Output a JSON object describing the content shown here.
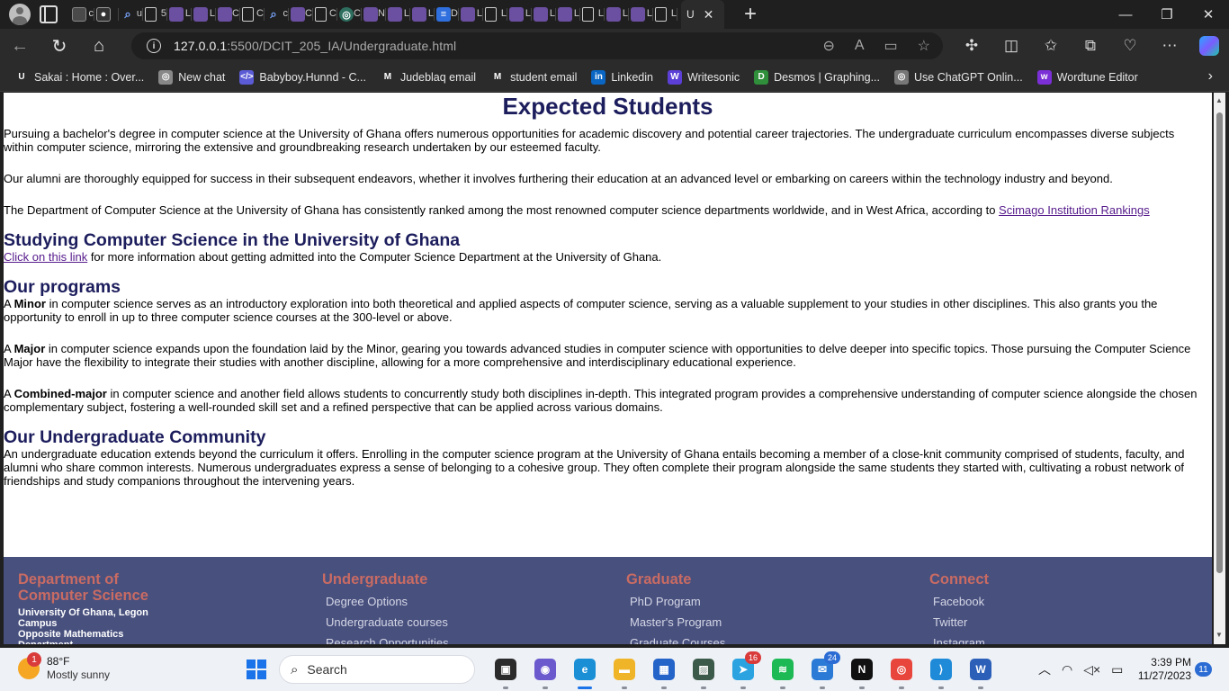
{
  "browser": {
    "tab_strip": {
      "mini_tabs": [
        {
          "icon": "tab-page-icon",
          "letter": "c"
        },
        {
          "icon": "github-icon",
          "letter": ""
        },
        {
          "icon": "search-icon",
          "letter": "u"
        },
        {
          "icon": "document-icon",
          "letter": "5"
        },
        {
          "icon": "site-icon",
          "letter": "L"
        },
        {
          "icon": "site-icon",
          "letter": "L"
        },
        {
          "icon": "site-icon",
          "letter": "C"
        },
        {
          "icon": "document-icon",
          "letter": "C"
        },
        {
          "icon": "search-icon",
          "letter": "c"
        },
        {
          "icon": "site-icon",
          "letter": "C"
        },
        {
          "icon": "document-icon",
          "letter": "C"
        },
        {
          "icon": "chatgpt-icon",
          "letter": "C"
        },
        {
          "icon": "site-icon",
          "letter": "N"
        },
        {
          "icon": "site-icon",
          "letter": "L"
        },
        {
          "icon": "site-icon",
          "letter": "L"
        },
        {
          "icon": "docs-icon",
          "letter": "D"
        },
        {
          "icon": "site-icon",
          "letter": "L"
        },
        {
          "icon": "document-icon",
          "letter": "L"
        },
        {
          "icon": "site-icon",
          "letter": "L"
        },
        {
          "icon": "site-icon",
          "letter": "L"
        },
        {
          "icon": "site-icon",
          "letter": "L"
        },
        {
          "icon": "document-icon",
          "letter": "L"
        },
        {
          "icon": "site-icon",
          "letter": "L"
        },
        {
          "icon": "site-icon",
          "letter": "L"
        },
        {
          "icon": "document-icon",
          "letter": "L"
        }
      ],
      "active_tab_label": "U",
      "new_tab_symbol": "+",
      "window_controls": {
        "minimize": "—",
        "restore": "❐",
        "close": "✕"
      }
    },
    "address_bar": {
      "url_host": "127.0.0.1",
      "url_rest": ":5500/DCIT_205_IA/Undergraduate.html"
    },
    "bookmarks": [
      {
        "label": "Sakai : Home : Over...",
        "icon": "sakai-icon",
        "color": "#2b2b2b",
        "glyph": "U"
      },
      {
        "label": "New chat",
        "icon": "chatgpt-icon",
        "color": "#888888",
        "glyph": "◎"
      },
      {
        "label": "Babyboy.Hunnd - C...",
        "icon": "code-icon",
        "color": "#5b5bd6",
        "glyph": "</>"
      },
      {
        "label": "Judeblaq email",
        "icon": "gmail-icon",
        "color": "#2b2b2b",
        "glyph": "M"
      },
      {
        "label": "student email",
        "icon": "gmail-icon",
        "color": "#2b2b2b",
        "glyph": "M"
      },
      {
        "label": "Linkedin",
        "icon": "linkedin-icon",
        "color": "#0a66c2",
        "glyph": "in"
      },
      {
        "label": "Writesonic",
        "icon": "writesonic-icon",
        "color": "#5b3fd6",
        "glyph": "W"
      },
      {
        "label": "Desmos | Graphing...",
        "icon": "desmos-icon",
        "color": "#2f8f3a",
        "glyph": "D"
      },
      {
        "label": "Use ChatGPT Onlin...",
        "icon": "chatgpt-icon",
        "color": "#777777",
        "glyph": "◎"
      },
      {
        "label": "Wordtune Editor",
        "icon": "wordtune-icon",
        "color": "#7b2fd6",
        "glyph": "w"
      }
    ]
  },
  "page": {
    "title": "Expected Students",
    "intro_paragraphs": [
      "Pursuing a bachelor's degree in computer science at the University of Ghana offers numerous opportunities for academic discovery and potential career trajectories. The undergraduate curriculum encompasses diverse subjects within computer science, mirroring the extensive and groundbreaking research undertaken by our esteemed faculty.",
      "Our alumni are thoroughly equipped for success in their subsequent endeavors, whether it involves furthering their education at an advanced level or embarking on careers within the technology industry and beyond."
    ],
    "ranking_text": "The Department of Computer Science at the University of Ghana has consistently ranked among the most renowned computer science departments worldwide, and in West Africa, according to ",
    "ranking_link": "Scimago Institution Rankings",
    "studying": {
      "heading": "Studying Computer Science in the University of Ghana",
      "link": "Click on this link",
      "text": " for more information about getting admitted into the Computer Science Department at the University of Ghana."
    },
    "programs": {
      "heading": "Our programs",
      "minor": {
        "prefix": "A ",
        "term": "Minor",
        "text": " in computer science serves as an introductory exploration into both theoretical and applied aspects of computer science, serving as a valuable supplement to your studies in other disciplines. This also grants you the opportunity to enroll in up to three computer science courses at the 300-level or above."
      },
      "major": {
        "prefix": "A ",
        "term": "Major",
        "text": " in computer science expands upon the foundation laid by the Minor, gearing you towards advanced studies in computer science with opportunities to delve deeper into specific topics. Those pursuing the Computer Science Major have the flexibility to integrate their studies with another discipline, allowing for a more comprehensive and interdisciplinary educational experience."
      },
      "combined": {
        "prefix": "A ",
        "term": "Combined-major",
        "text": " in computer science and another field allows students to concurrently study both disciplines in-depth. This integrated program provides a comprehensive understanding of computer science alongside the chosen complementary subject, fostering a well-rounded skill set and a refined perspective that can be applied across various domains."
      }
    },
    "community": {
      "heading": "Our Undergraduate Community",
      "text": "An undergraduate education extends beyond the curriculum it offers. Enrolling in the computer science program at the University of Ghana entails becoming a member of a close-knit community comprised of students, faculty, and alumni who share common interests. Numerous undergraduates express a sense of belonging to a cohesive group. They often complete their program alongside the same students they started with, cultivating a robust network of friendships and study companions throughout the intervening years."
    },
    "footer": {
      "dept_title": "Department of Computer Science",
      "address": [
        "University Of Ghana, Legon Campus",
        "Opposite Mathematics Department"
      ],
      "undergraduate": {
        "title": "Undergraduate",
        "links": [
          "Degree Options",
          "Undergraduate courses",
          "Research Opportunities"
        ]
      },
      "graduate": {
        "title": "Graduate",
        "links": [
          "PhD Program",
          "Master's Program",
          "Graduate Courses"
        ]
      },
      "connect": {
        "title": "Connect",
        "links": [
          "Facebook",
          "Twitter",
          "Instagram"
        ]
      }
    }
  },
  "taskbar": {
    "weather": {
      "temp": "88°F",
      "condition": "Mostly sunny",
      "badge": "1"
    },
    "search_placeholder": "Search",
    "apps": [
      {
        "name": "task-view-icon",
        "glyph": "▣",
        "color": "#2b2b2b"
      },
      {
        "name": "teams-chat-icon",
        "glyph": "◉",
        "color": "#6a5acd"
      },
      {
        "name": "edge-icon",
        "glyph": "e",
        "color": "#1a8fd6",
        "active": true
      },
      {
        "name": "file-explorer-icon",
        "glyph": "▬",
        "color": "#f0b429"
      },
      {
        "name": "store-icon",
        "glyph": "▦",
        "color": "#2463c8"
      },
      {
        "name": "photos-icon",
        "glyph": "▨",
        "color": "#3c5a4a"
      },
      {
        "name": "telegram-icon",
        "glyph": "➤",
        "color": "#2aa3e0",
        "count": "16"
      },
      {
        "name": "spotify-icon",
        "glyph": "≋",
        "color": "#1db954"
      },
      {
        "name": "mail-icon",
        "glyph": "✉",
        "color": "#2b7bd6",
        "count": "24"
      },
      {
        "name": "netflix-icon",
        "glyph": "N",
        "color": "#111111"
      },
      {
        "name": "chrome-icon",
        "glyph": "◎",
        "color": "#e8453c"
      },
      {
        "name": "vscode-icon",
        "glyph": "⟩",
        "color": "#1f8ad8"
      },
      {
        "name": "word-icon",
        "glyph": "W",
        "color": "#2b5fb8"
      }
    ],
    "time": "3:39 PM",
    "date": "11/27/2023",
    "notifications": "11"
  }
}
